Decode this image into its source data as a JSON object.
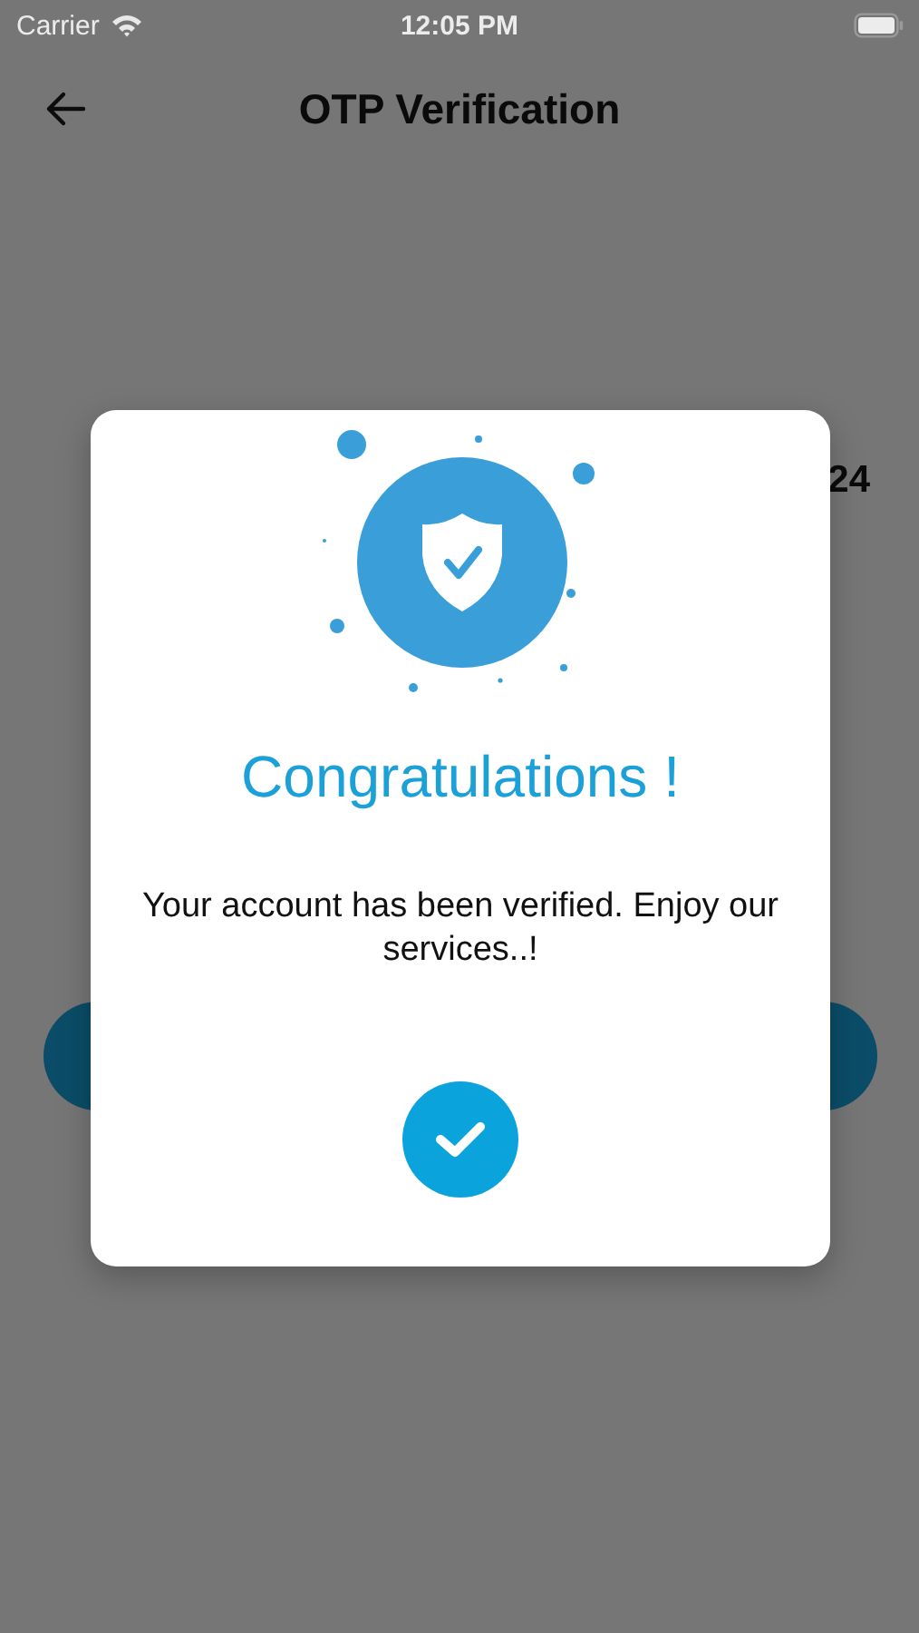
{
  "status_bar": {
    "carrier": "Carrier",
    "time": "12:05 PM"
  },
  "header": {
    "title": "OTP Verification"
  },
  "background": {
    "timer": "24"
  },
  "dialog": {
    "title": "Congratulations !",
    "message": "Your account has been verified. Enjoy our services..!"
  }
}
